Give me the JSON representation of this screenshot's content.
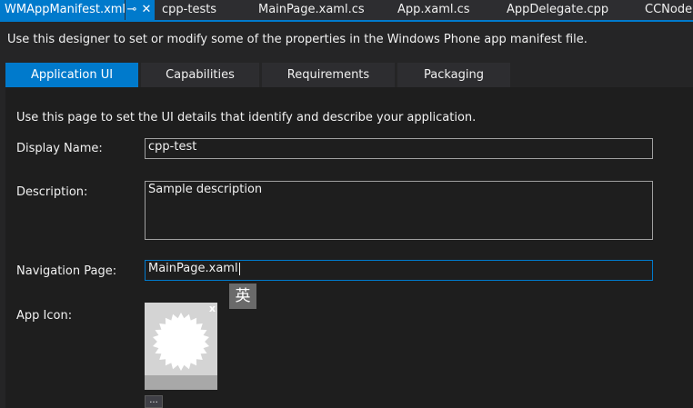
{
  "doc_tabs": [
    {
      "label": "WMAppManifest.xml",
      "active": true
    },
    {
      "label": "cpp-tests"
    },
    {
      "label": "MainPage.xaml.cs"
    },
    {
      "label": "App.xaml.cs"
    },
    {
      "label": "AppDelegate.cpp"
    },
    {
      "label": "CCNode."
    }
  ],
  "tab_controls": {
    "pin": "⊸",
    "close": "✕"
  },
  "intro": "Use this designer to set or modify some of the properties in the Windows Phone app manifest file.",
  "page_tabs": [
    {
      "label": "Application UI",
      "active": true
    },
    {
      "label": "Capabilities"
    },
    {
      "label": "Requirements"
    },
    {
      "label": "Packaging"
    }
  ],
  "panel": {
    "description": "Use this page to set the UI details that identify and describe your application.",
    "display_name": {
      "label": "Display Name:",
      "value": "cpp-test"
    },
    "description_field": {
      "label": "Description:",
      "value": "Sample description"
    },
    "navigation_page": {
      "label": "Navigation Page:",
      "value": "MainPage.xaml"
    },
    "app_icon": {
      "label": "App Icon:",
      "remove": "x",
      "browse": "..."
    },
    "ime_indicator": "英"
  },
  "colors": {
    "accent": "#007acc",
    "background": "#1e1e1e",
    "chrome": "#2d2d30"
  }
}
